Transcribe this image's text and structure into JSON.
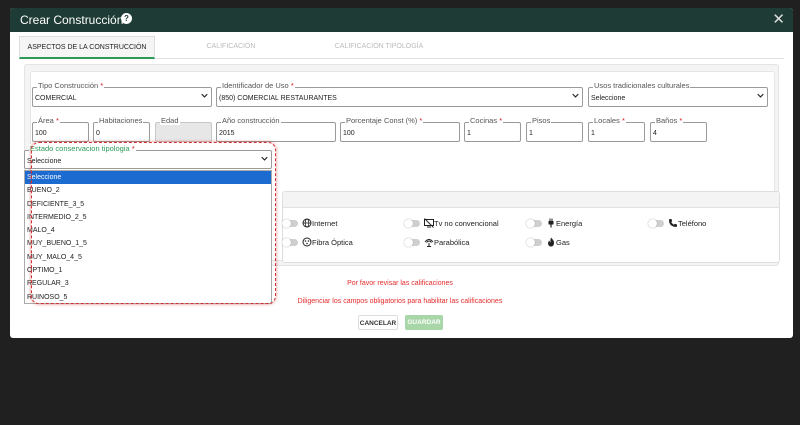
{
  "modal": {
    "title": "Crear Construcción",
    "help_icon": "question-circle-icon",
    "close_icon": "close-icon"
  },
  "tabs": [
    {
      "label": "ASPECTOS DE LA CONSTRUCCIÓN",
      "active": true
    },
    {
      "label": "CALIFICACIÓN",
      "active": false
    },
    {
      "label": "CALIFICACIÓN TIPOLOGÍA",
      "active": false
    }
  ],
  "fields": {
    "tipo_construccion": {
      "label": "Tipo Construcción",
      "required": "*",
      "value": "COMERCIAL"
    },
    "identificador_uso": {
      "label": "Identificador de Uso",
      "required": "*",
      "value": "(850) COMERCIAL RESTAURANTES"
    },
    "usos_tradicionales": {
      "label": "Usos tradicionales culturales",
      "required": "",
      "value": "Seleccione"
    },
    "area": {
      "label": "Área",
      "required": "*",
      "value": "100"
    },
    "habitaciones": {
      "label": "Habitaciones",
      "required": "",
      "value": "0"
    },
    "edad": {
      "label": "Edad",
      "required": "",
      "value": ""
    },
    "anio_construccion": {
      "label": "Año construcción",
      "required": "",
      "value": "2015"
    },
    "porcentaje_const": {
      "label": "Porcentaje Const (%)",
      "required": "*",
      "value": "100"
    },
    "cocinas": {
      "label": "Cocinas",
      "required": "*",
      "value": "1"
    },
    "pisos": {
      "label": "Pisos",
      "required": "",
      "value": "1"
    },
    "locales": {
      "label": "Locales",
      "required": "*",
      "value": "1"
    },
    "banos": {
      "label": "Baños",
      "required": "*",
      "value": "4"
    },
    "estado_conservacion": {
      "label": "Estado conservacion tipologia",
      "required": "*",
      "value": "Seleccione"
    }
  },
  "dropdown": {
    "options": [
      "Seleccione",
      "BUENO_2",
      "DEFICIENTE_3_5",
      "INTERMEDIO_2_5",
      "MALO_4",
      "MUY_BUENO_1_5",
      "MUY_MALO_4_5",
      "OPTIMO_1",
      "REGULAR_3",
      "RUINOSO_5"
    ],
    "selected_index": 0
  },
  "services": [
    {
      "label": "Internet",
      "icon": "globe-icon",
      "on": false
    },
    {
      "label": "Tv no convencional",
      "icon": "tv-icon",
      "on": false
    },
    {
      "label": "Energía",
      "icon": "plug-icon",
      "on": false
    },
    {
      "label": "Teléfono",
      "icon": "phone-icon",
      "on": false
    },
    {
      "label": "Fibra Óptica",
      "icon": "fiber-icon",
      "on": false
    },
    {
      "label": "Parabólica",
      "icon": "satellite-dish-icon",
      "on": false
    },
    {
      "label": "Gas",
      "icon": "flame-icon",
      "on": false
    }
  ],
  "messages": {
    "review": "Por favor revisar las calificaciones",
    "required": "Diligenciar los campos obligatorios para habilitar las calificaciones"
  },
  "buttons": {
    "cancel": "CANCELAR",
    "save": "GUARDAR"
  },
  "colors": {
    "header": "#1f3b35",
    "accent": "#2e9a58",
    "error": "#e52b2b",
    "selected_option": "#1b6bd1",
    "save_disabled": "#a8d6a8"
  }
}
